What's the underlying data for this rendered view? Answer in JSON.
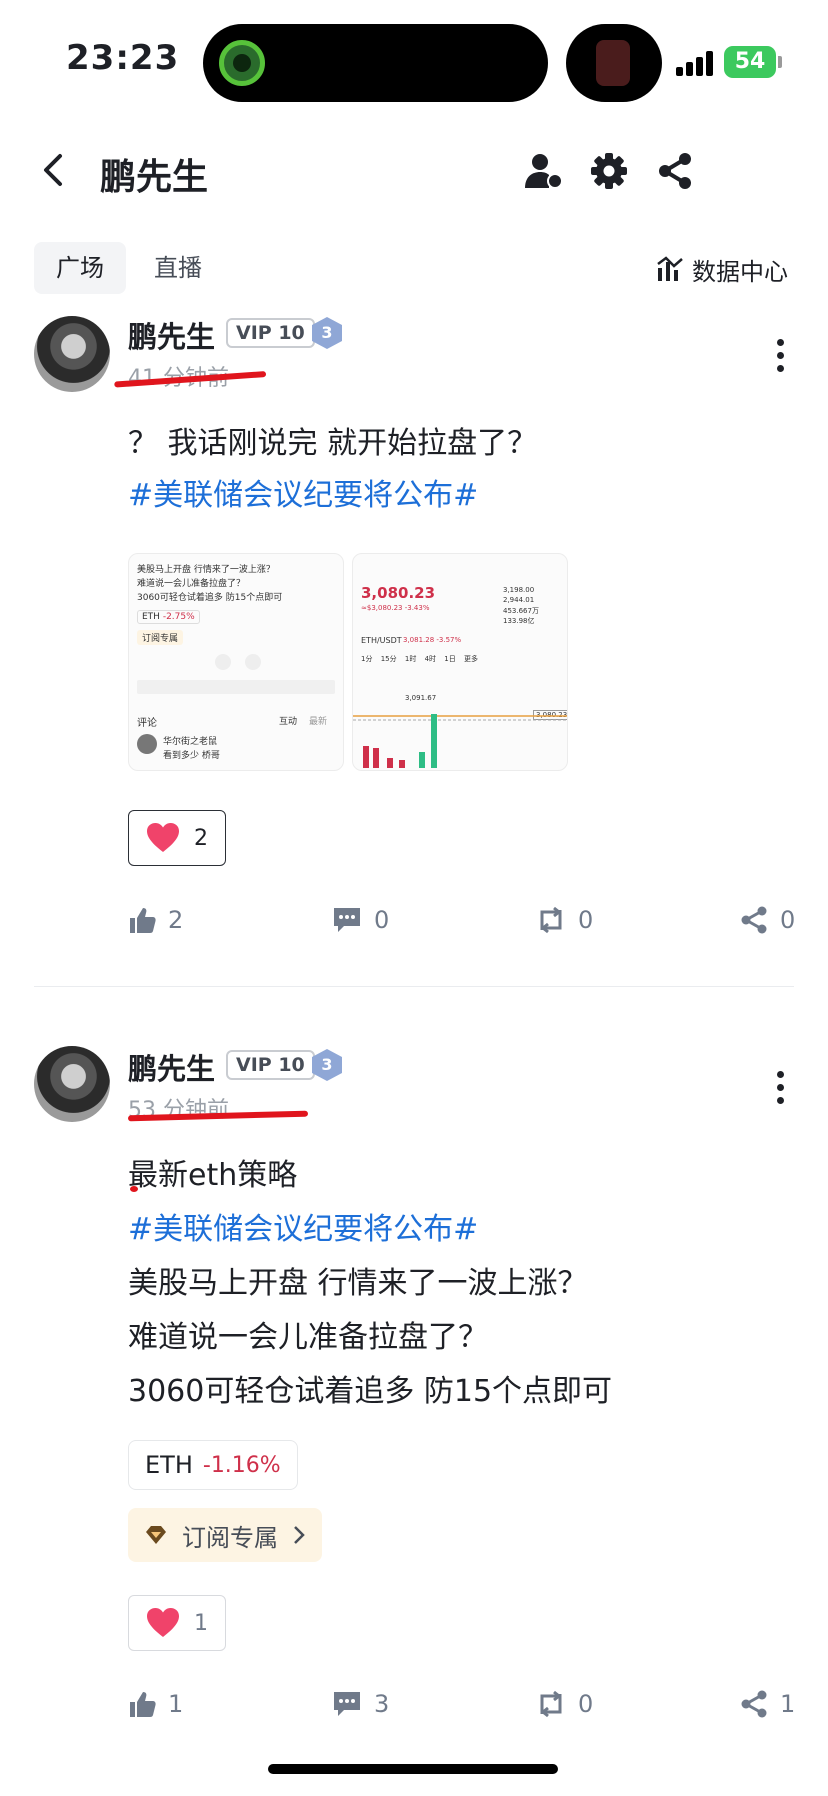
{
  "status": {
    "time": "23:23",
    "battery": "54"
  },
  "header": {
    "title": "鹏先生"
  },
  "tabs": [
    {
      "label": "广场"
    },
    {
      "label": "直播"
    }
  ],
  "data_center": {
    "label": "数据中心"
  },
  "posts": [
    {
      "author": "鹏先生",
      "vip": "VIP 10",
      "level": "3",
      "time": "41 分钟前",
      "lines": [
        "？ 我话刚说完 就开始拉盘了？"
      ],
      "hashtag": "#美联储会议纪要将公布#",
      "thumb1": {
        "lines": [
          "美股马上开盘 行情来了一波上涨？",
          "难道说一会儿准备拉盘了？",
          "3060可轻仓试着追多 防15个点即可"
        ],
        "chip": "ETH",
        "chip_change": "-2.75%",
        "sub": "订阅专属",
        "comments_label": "评论",
        "tab_interact": "互动",
        "tab_latest": "最新",
        "commenter": "华尔街之老鼠",
        "comment": "看到多少 桥哥"
      },
      "thumb2": {
        "price": "3,080.23",
        "price_sub": "≈$3,080.23 -3.43%",
        "pair": "ETH/USDT",
        "pair_info": "3,081.28 -3.57%",
        "stats": [
          "3,198.00",
          "2,944.01",
          "453.667万",
          "133.98亿"
        ],
        "intervals": [
          "1分",
          "15分",
          "1时",
          "4时",
          "1日",
          "更多"
        ],
        "high_label": "3,091.67",
        "last_label": "3,080.23"
      },
      "like_count": "2",
      "actions": {
        "likes": "2",
        "comments": "0",
        "reposts": "0",
        "shares": "0"
      }
    },
    {
      "author": "鹏先生",
      "vip": "VIP 10",
      "level": "3",
      "time": "53 分钟前",
      "first_line": "最新eth策略",
      "hashtag": "#美联储会议纪要将公布#",
      "lines": [
        "美股马上开盘 行情来了一波上涨？",
        "难道说一会儿准备拉盘了？",
        "3060可轻仓试着追多 防15个点即可"
      ],
      "chip": {
        "symbol": "ETH",
        "change": "-1.16%"
      },
      "sub": {
        "label": "订阅专属"
      },
      "like_count": "1",
      "actions": {
        "likes": "1",
        "comments": "3",
        "reposts": "0",
        "shares": "1"
      }
    }
  ],
  "colors": {
    "hashtag": "#1d6fd8",
    "negative": "#cf304a",
    "annotation": "#e0151d",
    "battery": "#3cc95e"
  }
}
